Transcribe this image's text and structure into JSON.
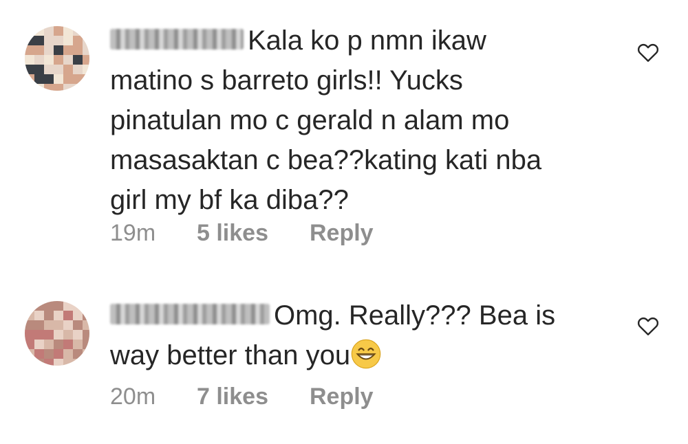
{
  "comments": [
    {
      "text": "Kala ko p nmn ikaw\nmatino s barreto girls!! Yucks\npinatulan mo c gerald n alam mo\nmasasaktan c bea??kating kati nba\ngirl my bf ka diba??",
      "time": "19m",
      "likes": "5 likes",
      "reply": "Reply",
      "avatar_colors": [
        "#e7d6ca",
        "#d6a68d",
        "#3a3f46",
        "#f2e6d6"
      ]
    },
    {
      "text": "Omg. Really??? Bea is\nway better than you",
      "time": "20m",
      "likes": "7 likes",
      "reply": "Reply",
      "emoji": "grinning-face-with-smiling-eyes",
      "avatar_colors": [
        "#d8b8a8",
        "#c27a77",
        "#e9d2c6",
        "#b98a7d"
      ]
    }
  ],
  "icons": {
    "like": "heart-outline-icon"
  }
}
